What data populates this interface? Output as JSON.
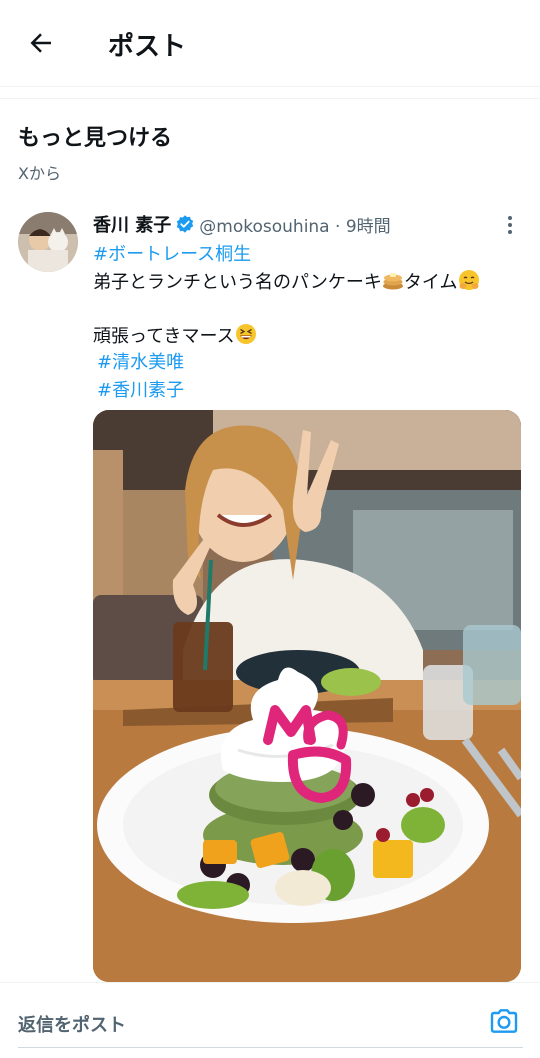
{
  "header": {
    "title": "ポスト"
  },
  "section": {
    "title": "もっと見つける",
    "subtitle": "Xから"
  },
  "post": {
    "author": "香川 素子",
    "meta": "@mokosouhina · 9時間",
    "line1_tag": "#ボートレース桐生",
    "line2_text_a": "弟子とランチという名のパンケーキ",
    "line2_text_b": "タイム",
    "line3_text": "頑張ってきマース",
    "tag2": "#清水美唯",
    "tag3": "#香川素子",
    "photo_overlay_letters": "MO"
  },
  "reply": {
    "placeholder": "返信をポスト"
  },
  "colors": {
    "accent": "#1d9bf0",
    "muted": "#536471",
    "overlay": "#e0267a"
  },
  "icons": [
    "back-arrow-icon",
    "verified-icon",
    "more-vertical-icon",
    "pancake-emoji-icon",
    "hugging-emoji-icon",
    "grinning-squint-emoji-icon",
    "camera-icon"
  ]
}
